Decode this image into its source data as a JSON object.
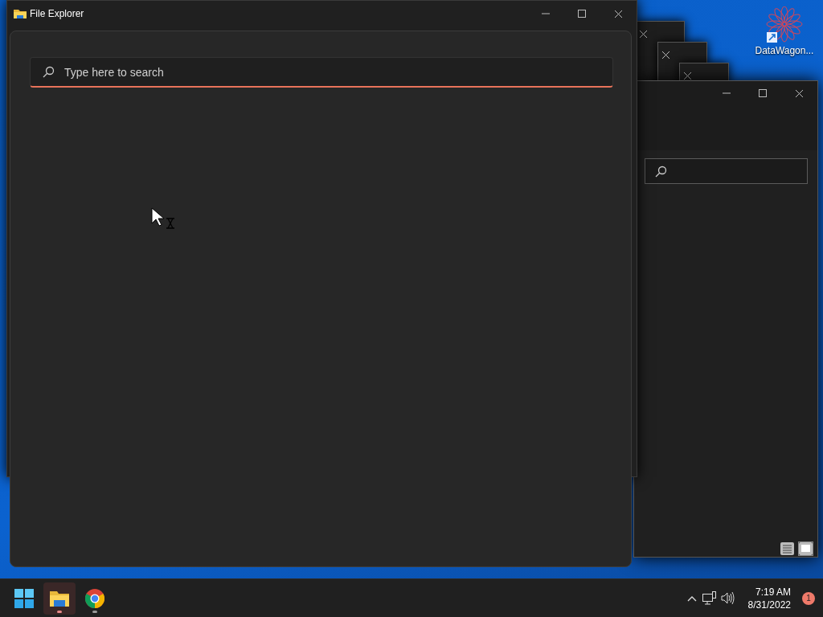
{
  "desktop": {
    "icons": [
      {
        "label": "DataWagon..."
      }
    ]
  },
  "stacked_windows": [
    {
      "kind": "ghost"
    },
    {
      "kind": "ghost"
    },
    {
      "kind": "ghost"
    }
  ],
  "back_window": {
    "view_buttons": [
      {
        "kind": "details",
        "selected": false
      },
      {
        "kind": "preview",
        "selected": true
      }
    ]
  },
  "main_window": {
    "title": "File Explorer",
    "search": {
      "placeholder": "Type here to search",
      "focused": true
    }
  },
  "taskbar": {
    "apps": [
      {
        "kind": "start"
      },
      {
        "kind": "explorer",
        "running": true,
        "selected": true
      },
      {
        "kind": "chrome",
        "running": true,
        "selected": false
      }
    ],
    "tray": {
      "time": "7:19 AM",
      "date": "8/31/2022",
      "notification_count": "1"
    }
  }
}
